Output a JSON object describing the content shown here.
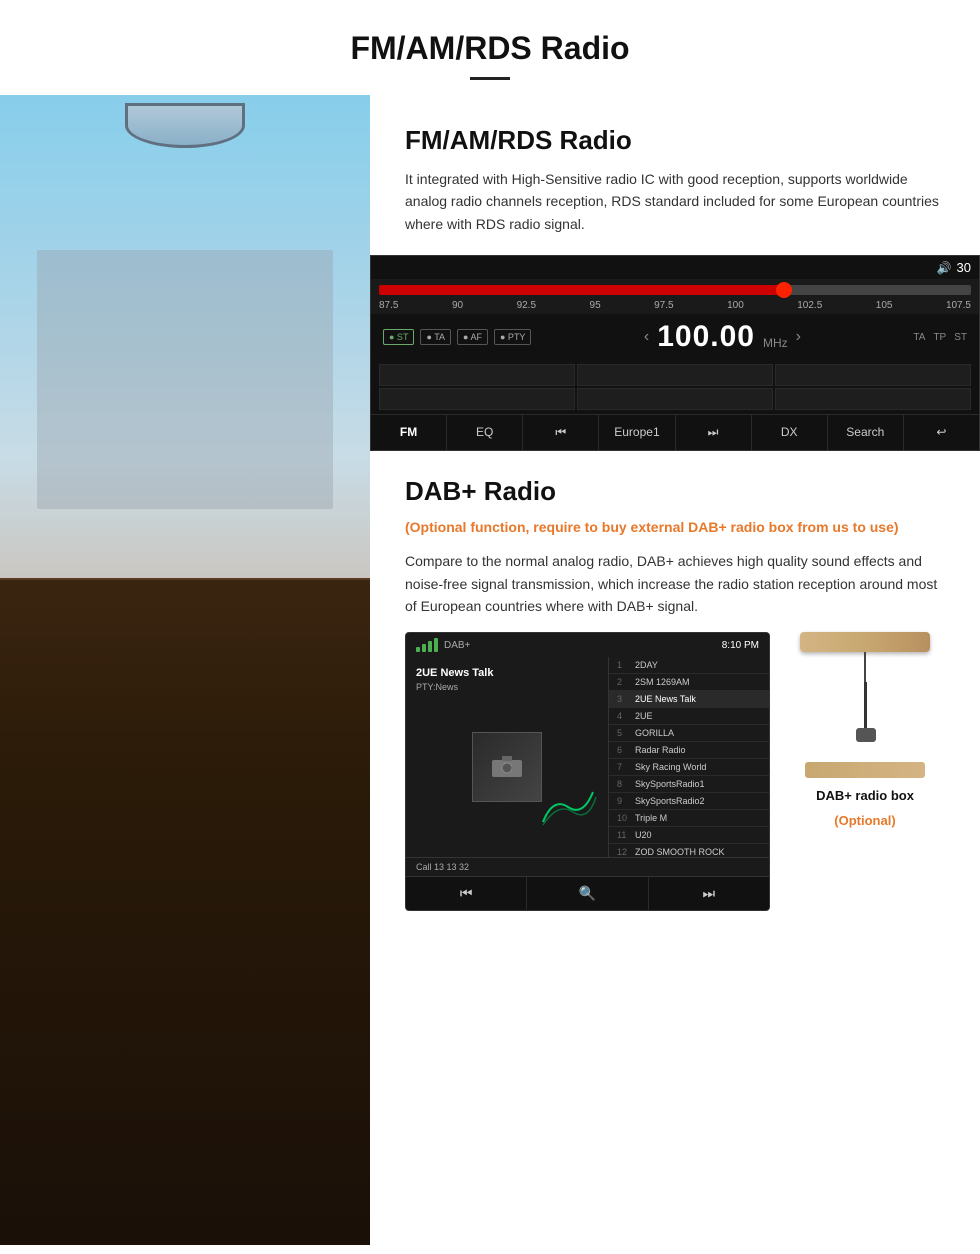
{
  "page": {
    "title": "FM/AM/RDS Radio",
    "header_divider": true
  },
  "fm_section": {
    "title": "FM/AM/RDS Radio",
    "description": "It integrated with High-Sensitive radio IC with good reception, supports worldwide analog radio channels reception, RDS standard included for some European countries where with RDS radio signal."
  },
  "radio_ui": {
    "volume": "30",
    "frequency": "100.00",
    "unit": "MHz",
    "freq_scale": [
      "87.5",
      "90",
      "92.5",
      "95",
      "97.5",
      "100",
      "102.5",
      "105",
      "107.5"
    ],
    "buttons": [
      "ST",
      "TA",
      "AF",
      "PTY"
    ],
    "right_buttons": [
      "TA",
      "TP",
      "ST"
    ],
    "toolbar": {
      "items": [
        "FM",
        "EQ",
        "⏮",
        "Europe1",
        "⏭",
        "DX",
        "Search",
        "↩"
      ]
    }
  },
  "dab_section": {
    "title": "DAB+ Radio",
    "optional_text": "(Optional function, require to buy external DAB+ radio box from us to use)",
    "description": "Compare to the normal analog radio, DAB+ achieves high quality sound effects and noise-free signal transmission, which increase the radio station reception around most of European countries where with DAB+ signal."
  },
  "dab_ui": {
    "label": "DAB+",
    "time": "8:10 PM",
    "station": "2UE News Talk",
    "pty": "PTY:News",
    "call_bar": "Call 13 13 32",
    "station_list": [
      {
        "num": "1",
        "name": "2DAY"
      },
      {
        "num": "2",
        "name": "2SM 1269AM"
      },
      {
        "num": "3",
        "name": "2UE News Talk"
      },
      {
        "num": "4",
        "name": "2UE"
      },
      {
        "num": "5",
        "name": "GORILLA"
      },
      {
        "num": "6",
        "name": "Radar Radio"
      },
      {
        "num": "7",
        "name": "Sky Racing World"
      },
      {
        "num": "8",
        "name": "SkySportsRadio1"
      },
      {
        "num": "9",
        "name": "SkySportsRadio2"
      },
      {
        "num": "10",
        "name": "Triple M"
      },
      {
        "num": "11",
        "name": "U20"
      },
      {
        "num": "12",
        "name": "ZOD SMOOTH ROCK"
      }
    ]
  },
  "dab_box": {
    "label": "DAB+ radio box",
    "optional": "(Optional)"
  }
}
